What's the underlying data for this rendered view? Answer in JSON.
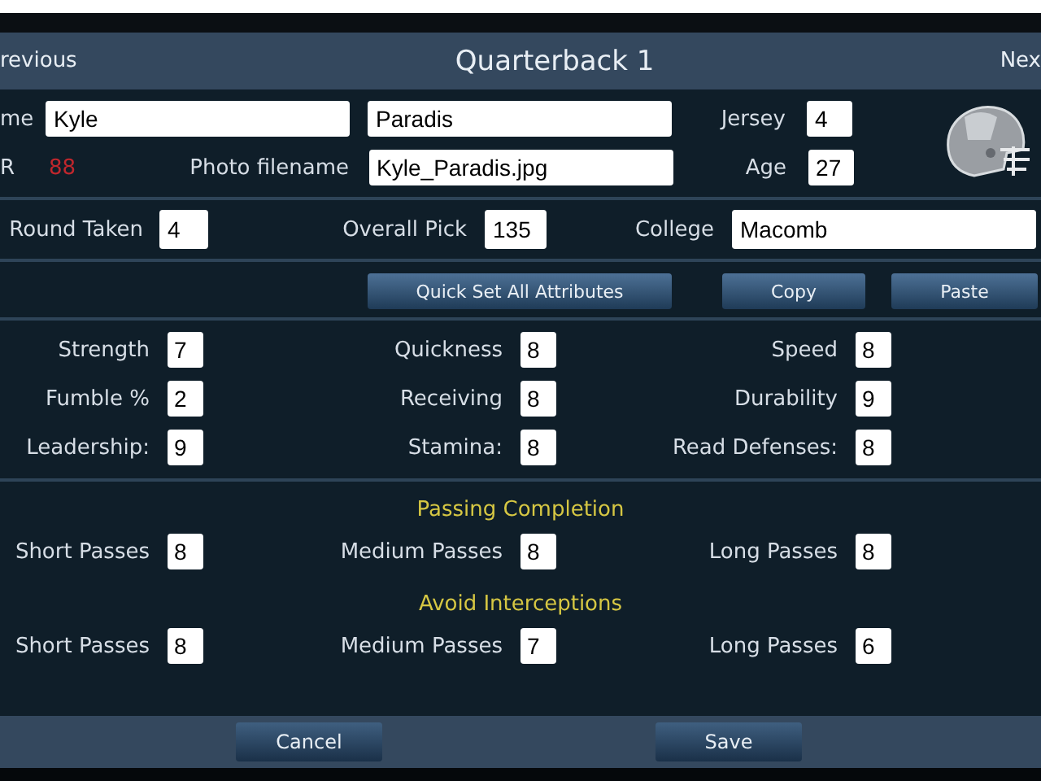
{
  "header": {
    "previous": "revious",
    "title": "Quarterback 1",
    "next": "Nex"
  },
  "identity": {
    "first_name_label": "me",
    "first_name": "Kyle",
    "last_name": "Paradis",
    "jersey_label": "Jersey",
    "jersey": "4",
    "rating_label": "R",
    "rating": "88",
    "photo_label": "Photo filename",
    "photo": "Kyle_Paradis.jpg",
    "age_label": "Age",
    "age": "27"
  },
  "draft": [
    {
      "label": "Round Taken",
      "value": "4"
    },
    {
      "label": "Overall Pick",
      "value": "135"
    },
    {
      "label": "College",
      "value": "Macomb"
    }
  ],
  "actions": [
    "Quick Set All Attributes",
    "Copy",
    "Paste"
  ],
  "attributes": [
    {
      "label": "Strength",
      "value": "7"
    },
    {
      "label": "Quickness",
      "value": "8"
    },
    {
      "label": "Speed",
      "value": "8"
    },
    {
      "label": "Fumble %",
      "value": "2"
    },
    {
      "label": "Receiving",
      "value": "8"
    },
    {
      "label": "Durability",
      "value": "9"
    },
    {
      "label": "Leadership:",
      "value": "9"
    },
    {
      "label": "Stamina:",
      "value": "8"
    },
    {
      "label": "Read Defenses:",
      "value": "8"
    }
  ],
  "sections": [
    {
      "title": "Passing Completion",
      "items": [
        {
          "label": "Short Passes",
          "value": "8"
        },
        {
          "label": "Medium Passes",
          "value": "8"
        },
        {
          "label": "Long Passes",
          "value": "8"
        }
      ]
    },
    {
      "title": "Avoid Interceptions",
      "items": [
        {
          "label": "Short Passes",
          "value": "8"
        },
        {
          "label": "Medium Passes",
          "value": "7"
        },
        {
          "label": "Long Passes",
          "value": "6"
        }
      ]
    }
  ],
  "footer": [
    "Cancel",
    "Save"
  ]
}
